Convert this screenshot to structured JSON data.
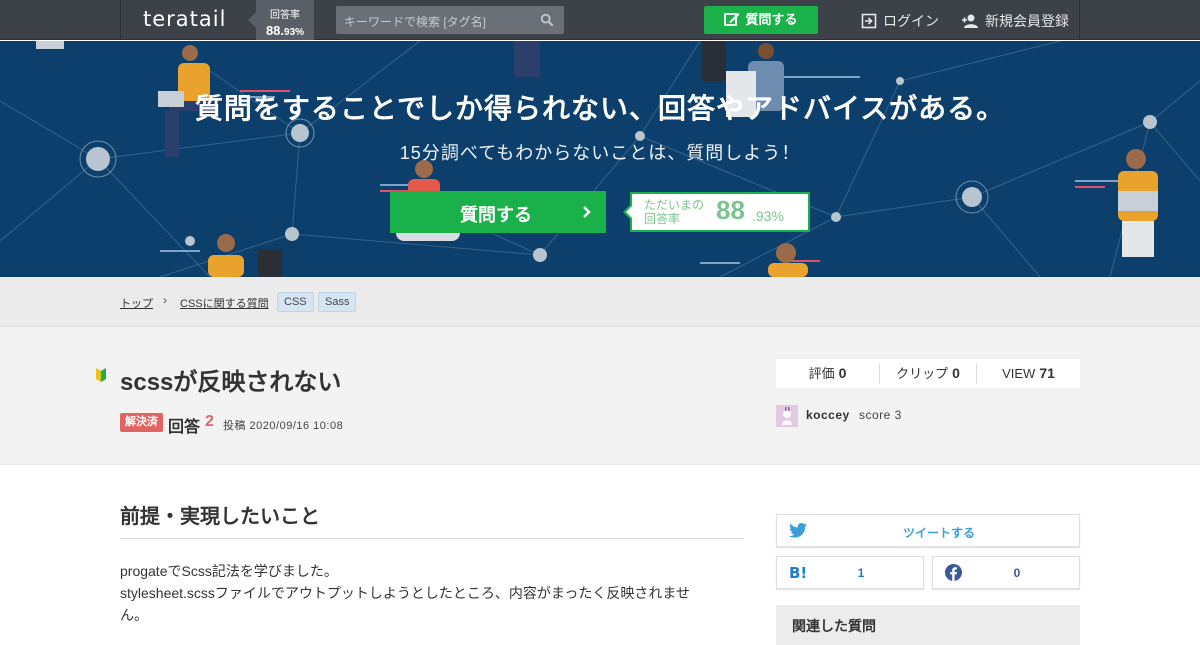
{
  "header": {
    "logo": "teratail",
    "rate_label": "回答率",
    "rate_int": "88.",
    "rate_dec": "93%",
    "search_placeholder": "キーワードで検索 [タグ名]",
    "ask_label": "質問する",
    "login_label": "ログイン",
    "signup_label": "新規会員登録"
  },
  "hero": {
    "title": "質問をすることでしか得られない、回答やアドバイスがある。",
    "subtitle": "15分調べてもわからないことは、質問しよう！",
    "ask_label": "質問する",
    "rate_label_line1": "ただいまの",
    "rate_label_line2": "回答率",
    "rate_int": "88",
    "rate_dec": ".93%"
  },
  "breadcrumb": {
    "items": [
      "トップ",
      "CSSに関する質問"
    ],
    "separator": "›",
    "tags": [
      "CSS",
      "Sass"
    ]
  },
  "question": {
    "title": "scssが反映されない",
    "status": "解決済",
    "answers_label": "回答",
    "answers_count": "2",
    "posted": "投稿 2020/09/16 10:08",
    "stats": {
      "rating_label": "評価",
      "rating_value": "0",
      "clip_label": "クリップ",
      "clip_value": "0",
      "view_label": "VIEW",
      "view_value": "71"
    },
    "user": {
      "name": "koccey",
      "score": "score 3"
    }
  },
  "content": {
    "section_title": "前提・実現したいこと",
    "lines": [
      "progateでScss記法を学びました。",
      "stylesheet.scssファイルでアウトプットしようとしたところ、内容がまったく反映されませ",
      "ん。"
    ]
  },
  "sidebar": {
    "tweet_label": "ツイートする",
    "hatena_count": "1",
    "facebook_count": "0",
    "related_title": "関連した質問"
  },
  "colors": {
    "header_bg": "#3d4148",
    "hero_bg": "#0c3f6b",
    "accent_green": "#1ab14a",
    "solved_red": "#e06464",
    "twitter_blue": "#3a9fd8",
    "facebook_blue": "#3b5998"
  }
}
